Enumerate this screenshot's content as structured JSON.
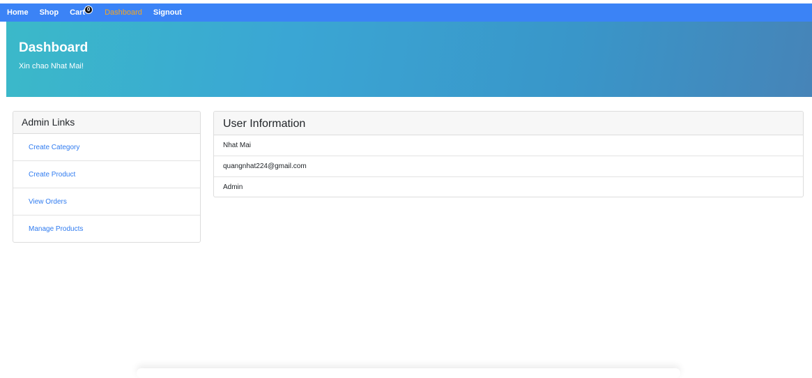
{
  "nav": {
    "items": [
      {
        "label": "Home"
      },
      {
        "label": "Shop"
      },
      {
        "label": "Cart"
      },
      {
        "label": "Dashboard"
      },
      {
        "label": "Signout"
      }
    ],
    "cart_count": "0",
    "active_color": "#f5a623",
    "bar_color": "#3b83f6"
  },
  "banner": {
    "title": "Dashboard",
    "subtitle": "Xin chao Nhat Mai!"
  },
  "admin_links": {
    "header": "Admin Links",
    "links": [
      {
        "label": "Create Category"
      },
      {
        "label": "Create Product"
      },
      {
        "label": "View Orders"
      },
      {
        "label": "Manage Products"
      }
    ],
    "link_color": "#2f7bf0"
  },
  "user_info": {
    "header": "User Information",
    "name": "Nhat Mai",
    "email": "quangnhat224@gmail.com",
    "role": "Admin"
  }
}
